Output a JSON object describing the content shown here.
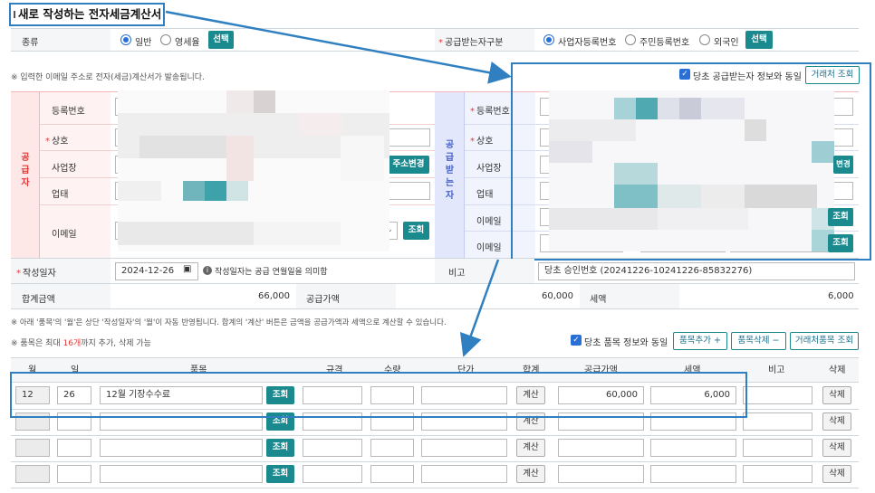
{
  "title": "새로 작성하는 전자세금계산서",
  "top_row": {
    "type_label": "종류",
    "type_options": [
      "일반",
      "영세율"
    ],
    "type_selected": "일반",
    "select_button": "선택",
    "receiver_type_label": "공급받는자구분",
    "receiver_options": [
      "사업자등록번호",
      "주민등록번호",
      "외국인"
    ],
    "receiver_selected": "사업자등록번호",
    "receiver_select_button": "선택"
  },
  "email_notice": "※ 입력한 이메일 주소로 전자(세금)계산서가 발송됩니다.",
  "buyer_same_checkbox": "당초 공급받는자 정보와 동일",
  "buyer_lookup_button": "거래처 조회",
  "supplier": {
    "side_label": [
      "공",
      "급",
      "자"
    ],
    "fields": [
      "등록번호",
      "상호",
      "사업장",
      "업태",
      "이메일"
    ],
    "address_change_button": "주소변경",
    "email_lookup_button": "조회"
  },
  "buyer": {
    "side_label": [
      "공",
      "급",
      "받",
      "는",
      "자"
    ],
    "fields": [
      "등록번호",
      "상호",
      "사업장",
      "업태",
      "이메일",
      "이메일"
    ],
    "address_change_button": "변경",
    "email_lookup_buttons": [
      "조회",
      "조회"
    ]
  },
  "write_date": {
    "label": "작성일자",
    "value": "2024-12-26",
    "hint": "작성일자는 공급 연월일을 의미함",
    "memo_label": "비고",
    "memo_value": "당초 승인번호 (20241226-10241226-85832276)"
  },
  "totals": {
    "total_label": "합계금액",
    "total_value": "66,000",
    "supply_label": "공급가액",
    "supply_value": "60,000",
    "tax_label": "세액",
    "tax_value": "6,000"
  },
  "notes": {
    "line1": "※ 아래 '품목'의 '월'은 상단 '작성일자'의 '월'이 자동 반영됩니다. 합계의 '계산' 버튼은 금액을 공급가액과 세액으로 계산할 수 있습니다.",
    "line2_prefix": "※ 품목은 최대 ",
    "line2_count": "16개",
    "line2_suffix": "까지 추가, 삭제 가능"
  },
  "item_toolbar": {
    "same_checkbox": "당초 품목 정보와 동일",
    "add_button": "품목추가 +",
    "delete_button": "품목삭제 −",
    "lookup_button": "거래처품목 조회"
  },
  "item_table": {
    "headers": [
      "월",
      "일",
      "품목",
      "규격",
      "수량",
      "단가",
      "합계",
      "공급가액",
      "세액",
      "비고",
      "삭제"
    ],
    "lookup_label": "조회",
    "calc_label": "계산",
    "delete_label": "삭제",
    "rows": [
      {
        "month": "12",
        "day": "26",
        "item": "12월 기장수수료",
        "supply": "60,000",
        "tax": "6,000"
      },
      {
        "month": "",
        "day": "",
        "item": "",
        "supply": "",
        "tax": ""
      },
      {
        "month": "",
        "day": "",
        "item": "",
        "supply": "",
        "tax": ""
      },
      {
        "month": "",
        "day": "",
        "item": "",
        "supply": "",
        "tax": ""
      }
    ]
  },
  "colors": {
    "accent_teal": "#1b8a8f",
    "annotation_blue": "#2f7fc1",
    "required_red": "#e23b3b"
  }
}
